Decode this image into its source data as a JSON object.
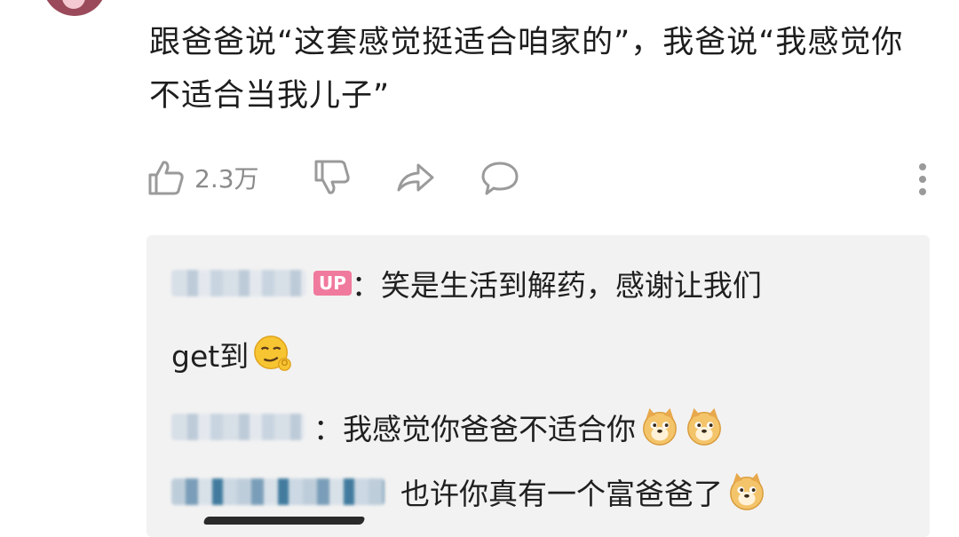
{
  "comment": {
    "text": "跟爸爸说“这套感觉挺适合咱家的”，我爸说“我感觉你不适合当我儿子”"
  },
  "actions": {
    "like_count": "2.3万"
  },
  "replies": [
    {
      "badge": "UP",
      "text_line1": "：笑是生活到解药，感谢让我们",
      "text_line2": "get到",
      "emoji": [
        "smirk-ok-emoji"
      ]
    },
    {
      "text": "：我感觉你爸爸不适合你",
      "emoji": [
        "doge-emoji",
        "doge-emoji"
      ]
    },
    {
      "text": "也许你真有一个富爸爸了",
      "emoji": [
        "doge-emoji"
      ]
    }
  ],
  "colors": {
    "up_badge": "#f07a9d",
    "reply_bg": "#f2f2f2",
    "icon_gray": "#9a9a9a"
  }
}
